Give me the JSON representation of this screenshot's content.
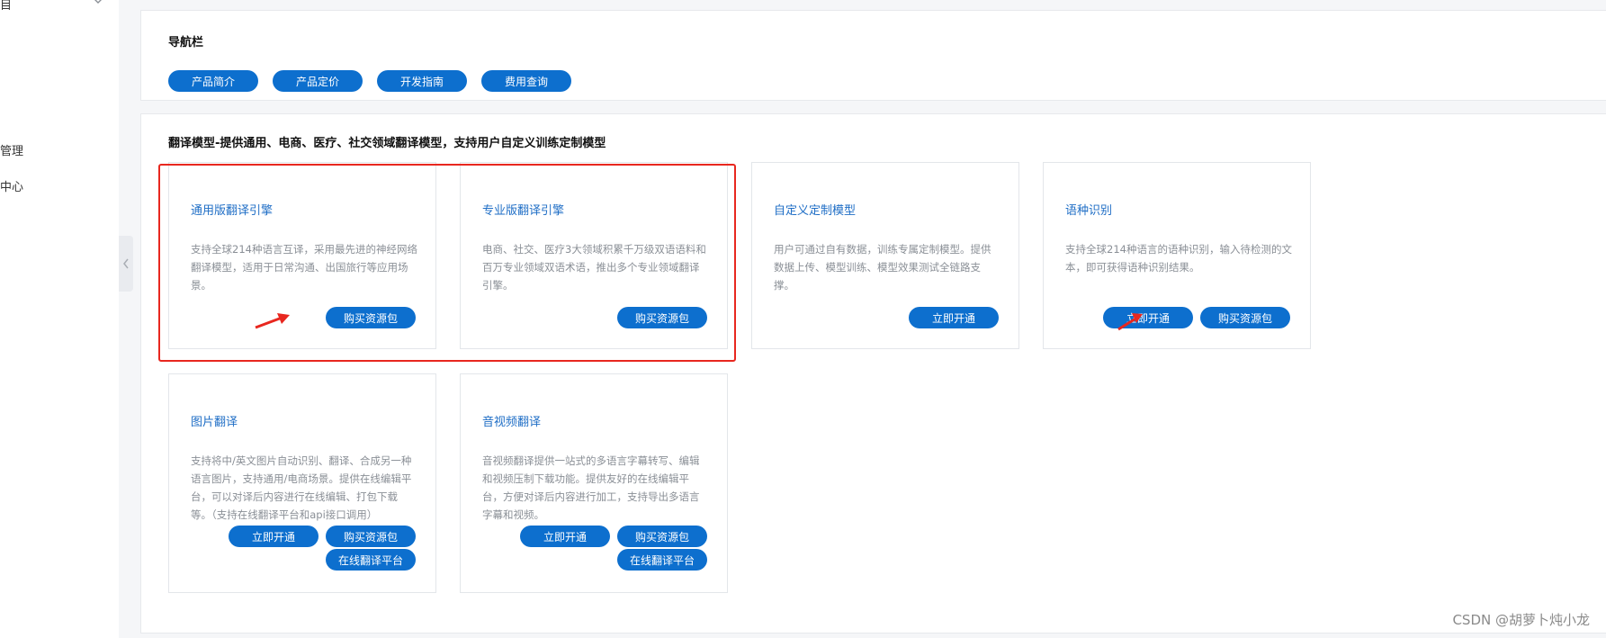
{
  "sidebar": {
    "items": [
      {
        "label": "目"
      },
      {
        "label": "管理"
      },
      {
        "label": "中心"
      }
    ]
  },
  "nav": {
    "title": "导航栏",
    "buttons": [
      {
        "label": "产品简介"
      },
      {
        "label": "产品定价"
      },
      {
        "label": "开发指南"
      },
      {
        "label": "费用查询"
      }
    ]
  },
  "models": {
    "title": "翻译模型-提供通用、电商、医疗、社交领域翻译模型，支持用户自定义训练定制模型",
    "cards": [
      {
        "title": "通用版翻译引擎",
        "desc": "支持全球214种语言互译，采用最先进的神经网络翻译模型，适用于日常沟通、出国旅行等应用场景。",
        "buttons": [
          "购买资源包"
        ]
      },
      {
        "title": "专业版翻译引擎",
        "desc": "电商、社交、医疗3大领域积累千万级双语语料和百万专业领域双语术语，推出多个专业领域翻译引擎。",
        "buttons": [
          "购买资源包"
        ]
      },
      {
        "title": "自定义定制模型",
        "desc": "用户可通过自有数据，训练专属定制模型。提供数据上传、模型训练、模型效果测试全链路支撑。",
        "buttons": [
          "立即开通"
        ]
      },
      {
        "title": "语种识别",
        "desc": "支持全球214种语言的语种识别，输入待检测的文本，即可获得语种识别结果。",
        "buttons": [
          "立即开通",
          "购买资源包"
        ]
      },
      {
        "title": "图片翻译",
        "desc": "支持将中/英文图片自动识别、翻译、合成另一种语言图片，支持通用/电商场景。提供在线编辑平台，可以对译后内容进行在线编辑、打包下载等。（支持在线翻译平台和api接口调用）",
        "buttons": [
          "立即开通",
          "购买资源包",
          "在线翻译平台"
        ]
      },
      {
        "title": "音视频翻译",
        "desc": "音视频翻译提供一站式的多语言字幕转写、编辑和视频压制下载功能。提供友好的在线编辑平台，方便对译后内容进行加工，支持导出多语言字幕和视频。",
        "buttons": [
          "立即开通",
          "购买资源包",
          "在线翻译平台"
        ]
      }
    ]
  },
  "watermark": "CSDN @胡萝卜炖小龙",
  "colors": {
    "accent": "#0d6fce",
    "highlight": "#e8271f",
    "title_link": "#1f6ec6"
  },
  "icons": {
    "sidebar_chevron": "chevron-down-icon",
    "collapse_handle": "chevron-left-icon",
    "annotation": "red-arrow-icon"
  }
}
